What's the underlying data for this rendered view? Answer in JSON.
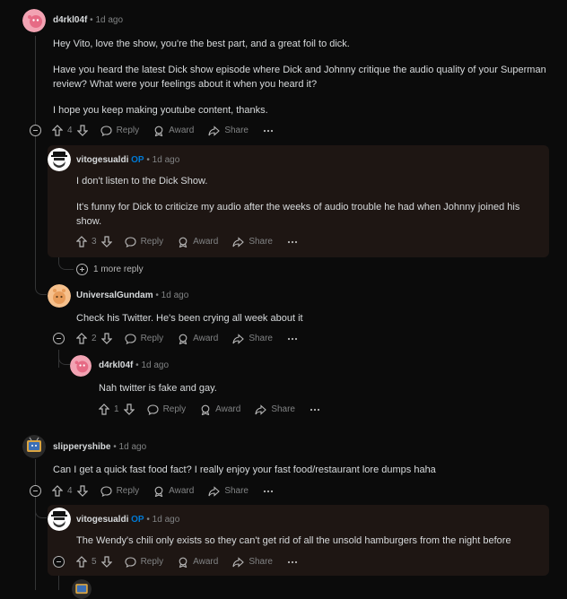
{
  "labels": {
    "reply": "Reply",
    "award": "Award",
    "share": "Share",
    "dot": "•",
    "op": "OP"
  },
  "colors": {
    "background": "#0b0b0b",
    "op_badge": "#0079d3",
    "highlight": "#1e1613",
    "text": "#d7dadc",
    "muted": "#818384"
  },
  "comments": [
    {
      "user": "d4rkl04f",
      "time": "1d ago",
      "paras": [
        "Hey Vito, love the show, you're the best part, and a great foil to dick.",
        "Have you heard the latest Dick show episode where Dick and Johnny critique the audio quality of your Superman review? What were your feelings about it when you heard it?",
        "I hope you keep making youtube content, thanks."
      ],
      "votes": "4",
      "avatar": "pink-snoo-avatar"
    },
    {
      "user": "vitogesualdi",
      "time": "1d ago",
      "op": true,
      "paras": [
        "I don't listen to the Dick Show.",
        "It's funny for Dick to criticize my audio after the weeks of audio trouble he had when Johnny joined his show."
      ],
      "votes": "3",
      "avatar": "vito-avatar"
    },
    {
      "user": "UniversalGundam",
      "time": "1d ago",
      "paras": [
        "Check his Twitter. He's been crying all week about it"
      ],
      "votes": "2",
      "avatar": "orange-snoo-avatar"
    },
    {
      "user": "d4rkl04f",
      "time": "1d ago",
      "paras": [
        "Nah twitter is fake and gay."
      ],
      "votes": "1",
      "avatar": "pink-snoo-avatar"
    },
    {
      "user": "slipperyshibe",
      "time": "1d ago",
      "paras": [
        "Can I get a quick fast food fact? I really enjoy your fast food/restaurant lore dumps haha"
      ],
      "votes": "4",
      "avatar": "tv-avatar"
    },
    {
      "user": "vitogesualdi",
      "time": "1d ago",
      "op": true,
      "paras": [
        "The Wendy's chili only exists so they can't get rid of all the unsold hamburgers from the night before"
      ],
      "votes": "5",
      "avatar": "vito-avatar"
    }
  ],
  "more_replies": "1 more reply"
}
